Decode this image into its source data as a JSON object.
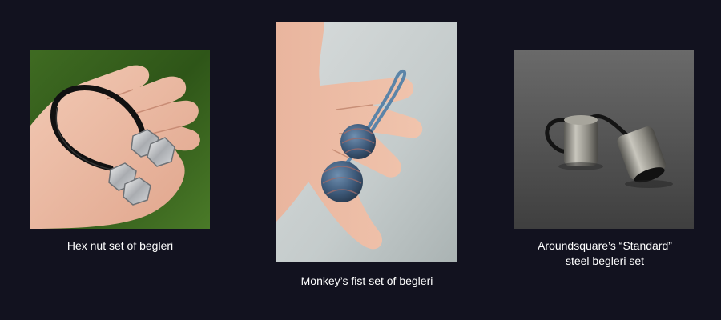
{
  "items": [
    {
      "caption": "Hex nut set of begleri",
      "photo_subject": "Hand holding hex nut begleri on black cord over grass"
    },
    {
      "caption": "Monkey’s fist set of begleri",
      "photo_subject": "Hand holding blue paracord monkey's fist begleri"
    },
    {
      "caption_line1": "Aroundsquare’s “Standard”",
      "caption_line2": "steel begleri set",
      "photo_subject": "Two steel cylinder beads on black cord on grey surface"
    }
  ],
  "colors": {
    "background": "#12121f",
    "caption_text": "#ffffff"
  }
}
